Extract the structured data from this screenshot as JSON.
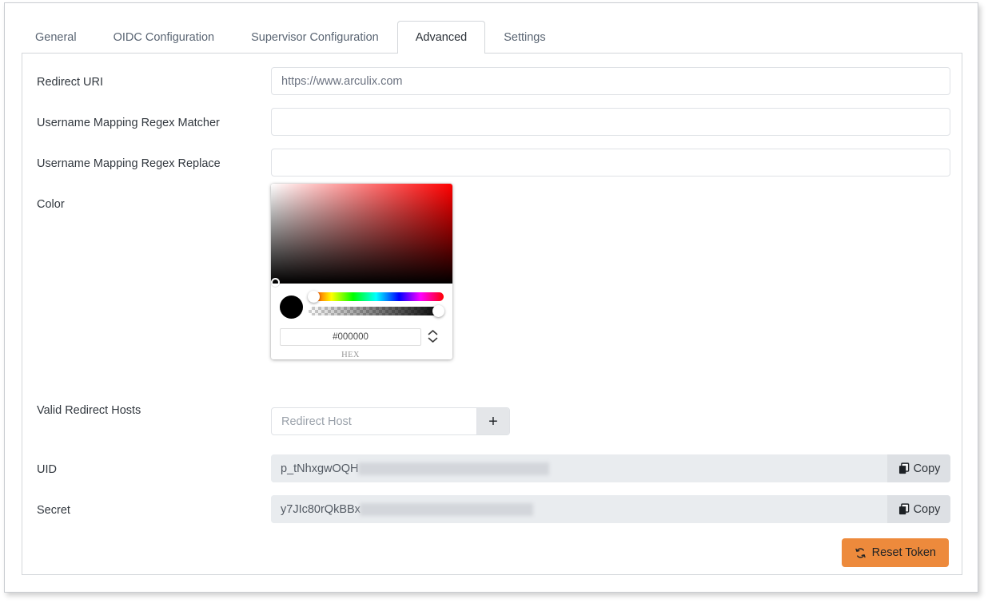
{
  "tabs": [
    {
      "label": "General",
      "active": false
    },
    {
      "label": "OIDC Configuration",
      "active": false
    },
    {
      "label": "Supervisor Configuration",
      "active": false
    },
    {
      "label": "Advanced",
      "active": true
    },
    {
      "label": "Settings",
      "active": false
    }
  ],
  "form": {
    "redirect_uri": {
      "label": "Redirect URI",
      "value": "https://www.arculix.com",
      "placeholder": ""
    },
    "username_mapping_regex_matcher": {
      "label": "Username Mapping Regex Matcher",
      "value": "",
      "placeholder": ""
    },
    "username_mapping_regex_replace": {
      "label": "Username Mapping Regex Replace",
      "value": "",
      "placeholder": ""
    },
    "color": {
      "label": "Color",
      "hex_value": "#000000",
      "format_label": "HEX",
      "swatch_color": "#000000",
      "hue_base_color": "#ff0000",
      "stepper_icon": "chevron-up-down-icon"
    },
    "valid_redirect_hosts": {
      "label": "Valid Redirect Hosts",
      "value": "",
      "placeholder": "Redirect Host",
      "add_button_label": "+"
    },
    "uid": {
      "label": "UID",
      "value": "p_tNhxgwOQH",
      "copy_label": "Copy",
      "copy_icon": "copy-icon",
      "redacted": true
    },
    "secret": {
      "label": "Secret",
      "value": "y7JIc80rQkBBx",
      "copy_label": "Copy",
      "copy_icon": "copy-icon",
      "redacted": true
    }
  },
  "actions": {
    "reset_token": {
      "label": "Reset Token",
      "icon": "refresh-icon",
      "color": "#ed8a3c"
    }
  },
  "theme": {
    "accent": "#ed8a3c",
    "border": "#d3d6da",
    "input_border": "#dfe2e6",
    "readonly_bg": "#e9ecef",
    "text": "#32383f",
    "muted_text": "#6b7280"
  }
}
